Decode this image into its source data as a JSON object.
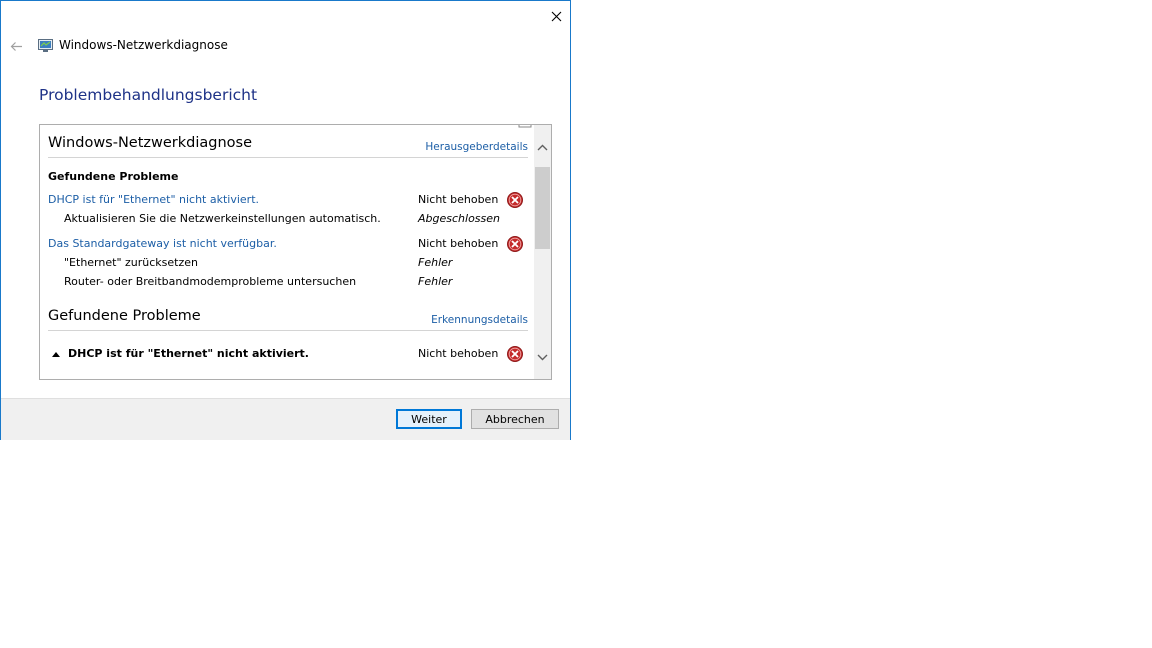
{
  "window": {
    "title": "Windows-Netzwerkdiagnose",
    "heading": "Problembehandlungsbericht"
  },
  "report": {
    "section1": {
      "title": "Windows-Netzwerkdiagnose",
      "link": "Herausgeberdetails"
    },
    "found_label": "Gefundene Probleme",
    "problems": [
      {
        "text": "DHCP ist für \"Ethernet\" nicht aktiviert.",
        "status": "Nicht behoben"
      },
      {
        "text": "Das Standardgateway ist nicht verfügbar.",
        "status": "Nicht behoben"
      }
    ],
    "steps": [
      {
        "text": "Aktualisieren Sie die Netzwerkeinstellungen automatisch.",
        "status": "Abgeschlossen"
      },
      {
        "text": "\"Ethernet\" zurücksetzen",
        "status": "Fehler"
      },
      {
        "text": "Router- oder Breitbandmodemprobleme untersuchen",
        "status": "Fehler"
      }
    ],
    "section2": {
      "title": "Gefundene Probleme",
      "link": "Erkennungsdetails"
    },
    "detail_problem": {
      "text": "DHCP ist für \"Ethernet\" nicht aktiviert.",
      "status": "Nicht behoben"
    }
  },
  "buttons": {
    "next": "Weiter",
    "cancel": "Abbrechen"
  },
  "colors": {
    "accent": "#0078d7",
    "link": "#1c5ea6",
    "heading": "#1e3287",
    "error": "#c42b2b"
  },
  "icons": [
    "close-icon",
    "back-arrow-icon",
    "network-diagnostics-icon",
    "error-icon",
    "expand-arrow-icon",
    "chevron-up-icon",
    "chevron-down-icon"
  ]
}
